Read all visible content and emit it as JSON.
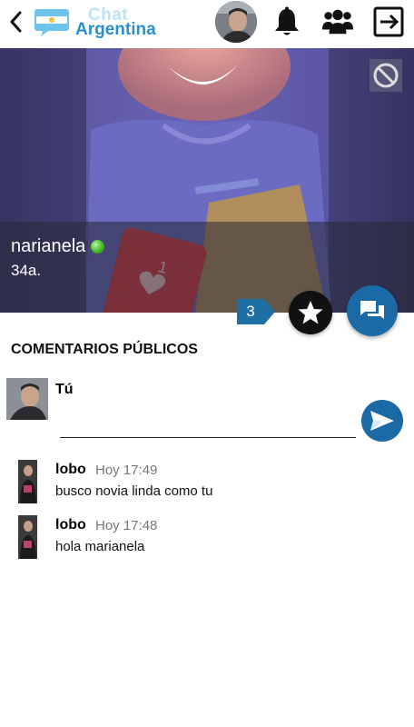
{
  "header": {
    "logo_top": "Chat",
    "logo_bottom": "Argentina",
    "icons": [
      "back-icon",
      "bell-icon",
      "users-icon",
      "logout-icon"
    ]
  },
  "profile": {
    "name": "narianela",
    "age": "34a.",
    "online": true,
    "rating_count": "3"
  },
  "comments_section": {
    "title": "COMENTARIOS PÚBLICOS",
    "me_label": "Tú",
    "input_value": "",
    "input_placeholder": ""
  },
  "comments": [
    {
      "author": "lobo",
      "time": "Hoy 17:49",
      "text": "busco novia linda como tu"
    },
    {
      "author": "lobo",
      "time": "Hoy 17:48",
      "text": "hola marianela"
    }
  ],
  "colors": {
    "accent": "#1b6aa5",
    "online": "#37b51c"
  }
}
